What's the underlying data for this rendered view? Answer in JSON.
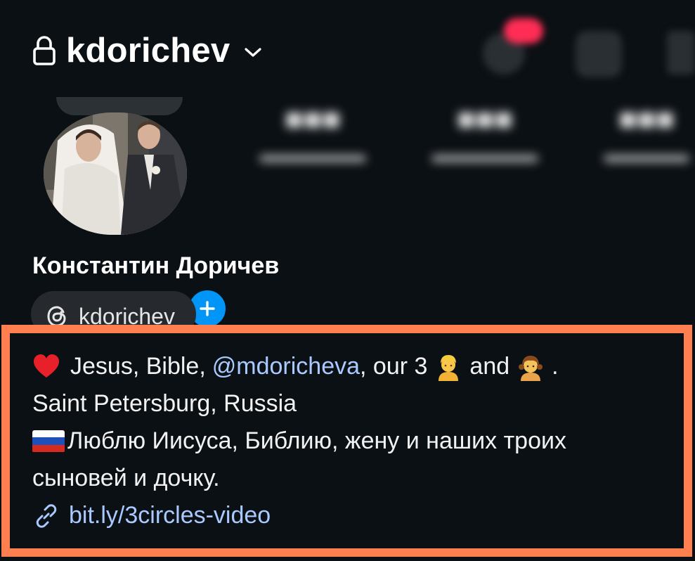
{
  "header": {
    "username": "kdorichev",
    "icons": {
      "lock": "lock-icon",
      "chevron": "chevron-down-icon"
    }
  },
  "profile": {
    "full_name": "Константин Доричев",
    "threads_chip": {
      "label": "kdorichev",
      "icon": "threads-icon"
    }
  },
  "bio": {
    "line1": {
      "heart_icon": "red-heart-emoji",
      "text_before": "Jesus, Bible,",
      "mention": "@mdoricheva",
      "text_after": ", our 3",
      "boy_icon": "boy-emoji",
      "and": "and",
      "girl_icon": "girl-emoji",
      "end": "."
    },
    "line2": "Saint Petersburg, Russia",
    "line3": {
      "flag_icon": "russia-flag-emoji",
      "text": "Люблю Иисуса, Библию, жену и наших троих"
    },
    "line4": "сыновей и дочку.",
    "link": {
      "icon": "link-icon",
      "url": "bit.ly/3circles-video"
    }
  },
  "colors": {
    "background": "#0b1014",
    "highlight_border": "#ff7f50",
    "link": "#a9c9ff",
    "add_story_button": "#0095f6",
    "chip_background": "#262a2f"
  }
}
